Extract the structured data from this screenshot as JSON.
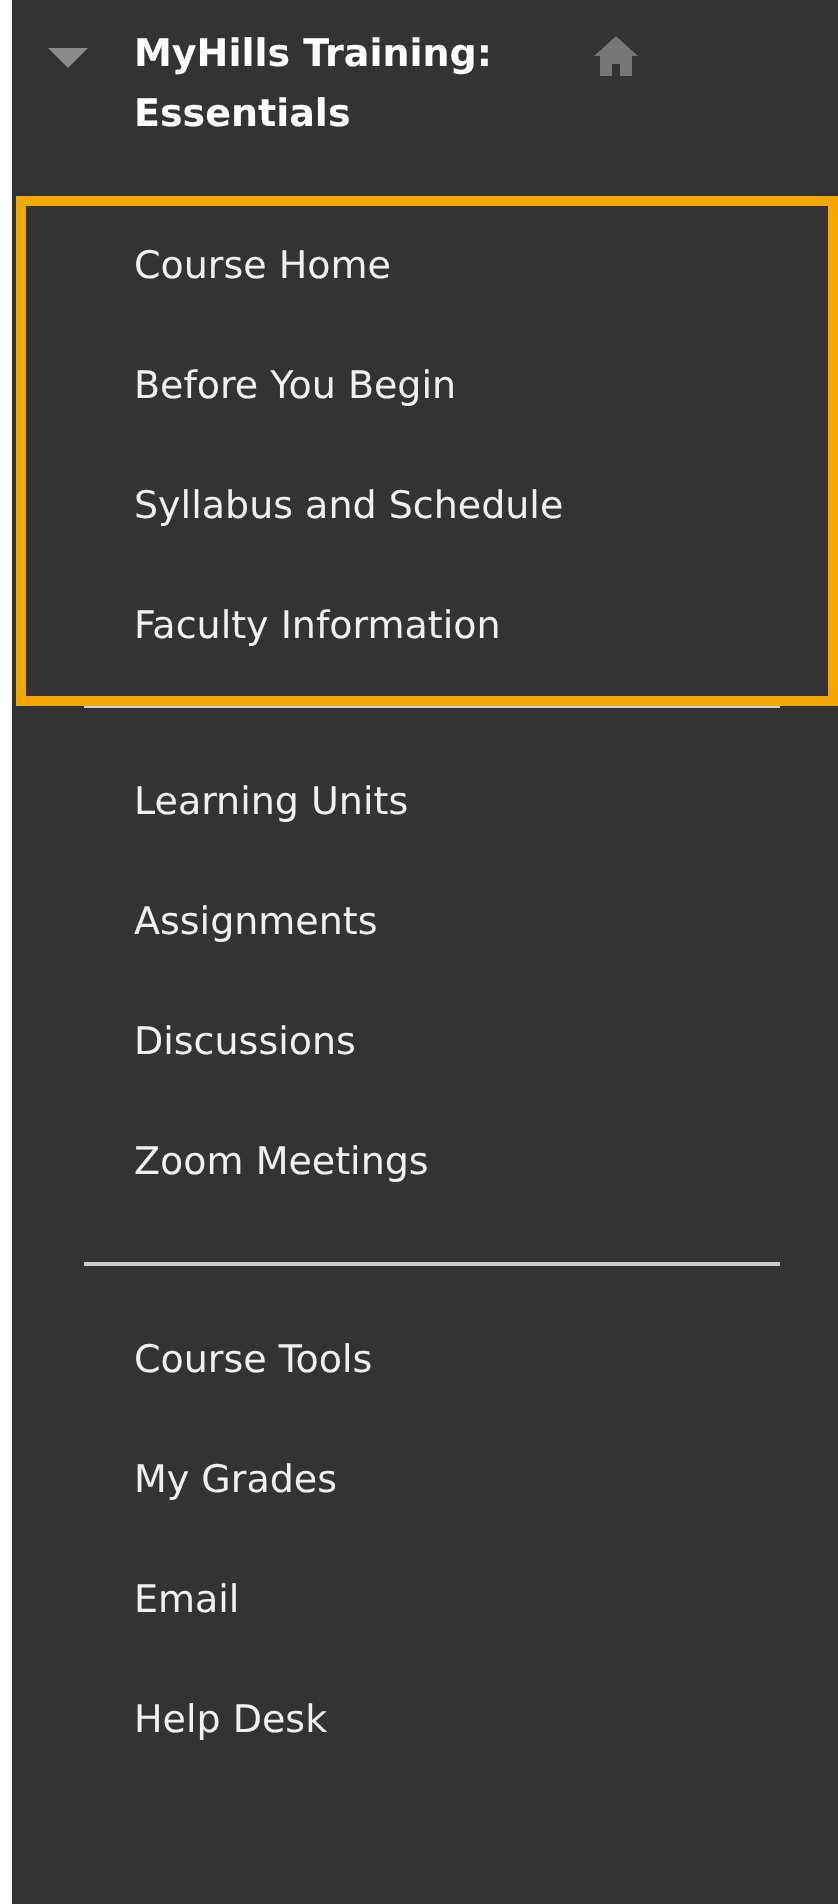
{
  "course": {
    "title": "MyHills Training: Essentials",
    "expanded": true
  },
  "groups": [
    {
      "highlighted": true,
      "items": [
        "Course Home",
        "Before You Begin",
        "Syllabus and Schedule",
        "Faculty Information"
      ]
    },
    {
      "highlighted": false,
      "items": [
        "Learning Units",
        "Assignments",
        "Discussions",
        "Zoom Meetings"
      ]
    },
    {
      "highlighted": false,
      "items": [
        "Course Tools",
        "My Grades",
        "Email",
        "Help Desk"
      ]
    }
  ]
}
